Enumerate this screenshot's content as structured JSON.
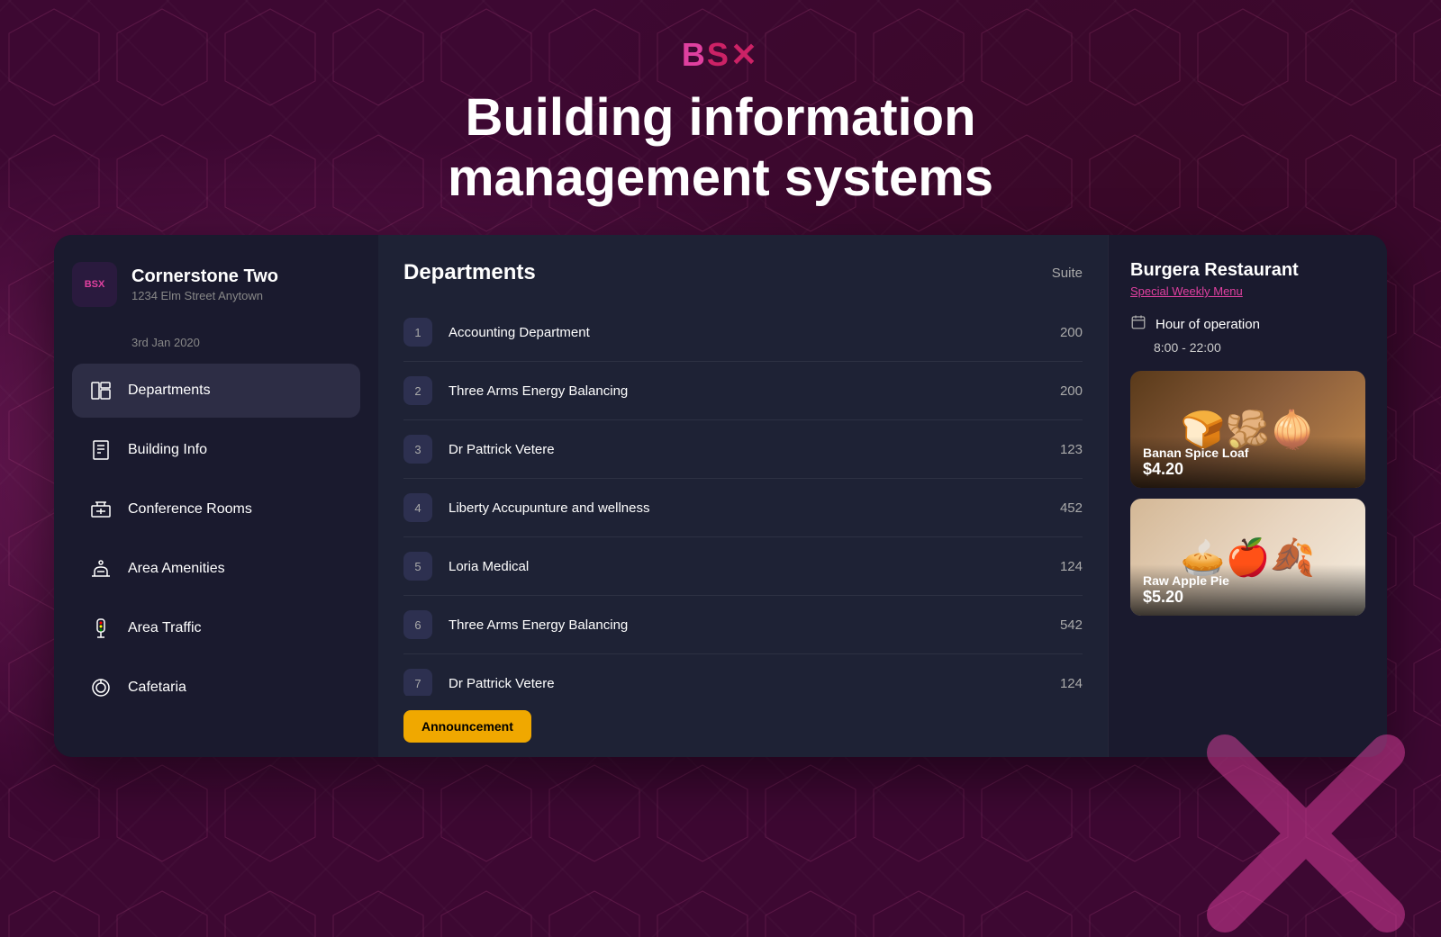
{
  "header": {
    "logo": "BSX",
    "title_line1": "Building information",
    "title_line2": "management systems"
  },
  "building": {
    "name": "Cornerstone Two",
    "address": "1234 Elm Street Anytown",
    "date": "3rd Jan 2020",
    "logo_text": "BSX"
  },
  "nav": {
    "items": [
      {
        "id": "departments",
        "label": "Departments",
        "active": true
      },
      {
        "id": "building-info",
        "label": "Building Info",
        "active": false
      },
      {
        "id": "conference-rooms",
        "label": "Conference Rooms",
        "active": false
      },
      {
        "id": "area-amenities",
        "label": "Area Amenities",
        "active": false
      },
      {
        "id": "area-traffic",
        "label": "Area Traffic",
        "active": false
      },
      {
        "id": "cafetaria",
        "label": "Cafetaria",
        "active": false
      }
    ]
  },
  "departments": {
    "title": "Departments",
    "suite_header": "Suite",
    "items": [
      {
        "num": 1,
        "name": "Accounting Department",
        "suite": "200"
      },
      {
        "num": 2,
        "name": "Three Arms Energy Balancing",
        "suite": "200"
      },
      {
        "num": 3,
        "name": "Dr Pattrick Vetere",
        "suite": "123"
      },
      {
        "num": 4,
        "name": "Liberty Accupunture and wellness",
        "suite": "452"
      },
      {
        "num": 5,
        "name": "Loria Medical",
        "suite": "124"
      },
      {
        "num": 6,
        "name": "Three Arms Energy Balancing",
        "suite": "542"
      },
      {
        "num": 7,
        "name": "Dr Pattrick Vetere",
        "suite": "124"
      }
    ],
    "announcement_btn": "Announcement"
  },
  "restaurant": {
    "name": "Burgera Restaurant",
    "special_menu_link": "Special Weekly Menu",
    "hours_label": "Hour of operation",
    "hours_value": "8:00 - 22:00",
    "food_items": [
      {
        "id": "banan-spice-loaf",
        "name": "Banan Spice Loaf",
        "price": "$4.20"
      },
      {
        "id": "raw-apple-pie",
        "name": "Raw Apple Pie",
        "price": "$5.20"
      }
    ]
  }
}
